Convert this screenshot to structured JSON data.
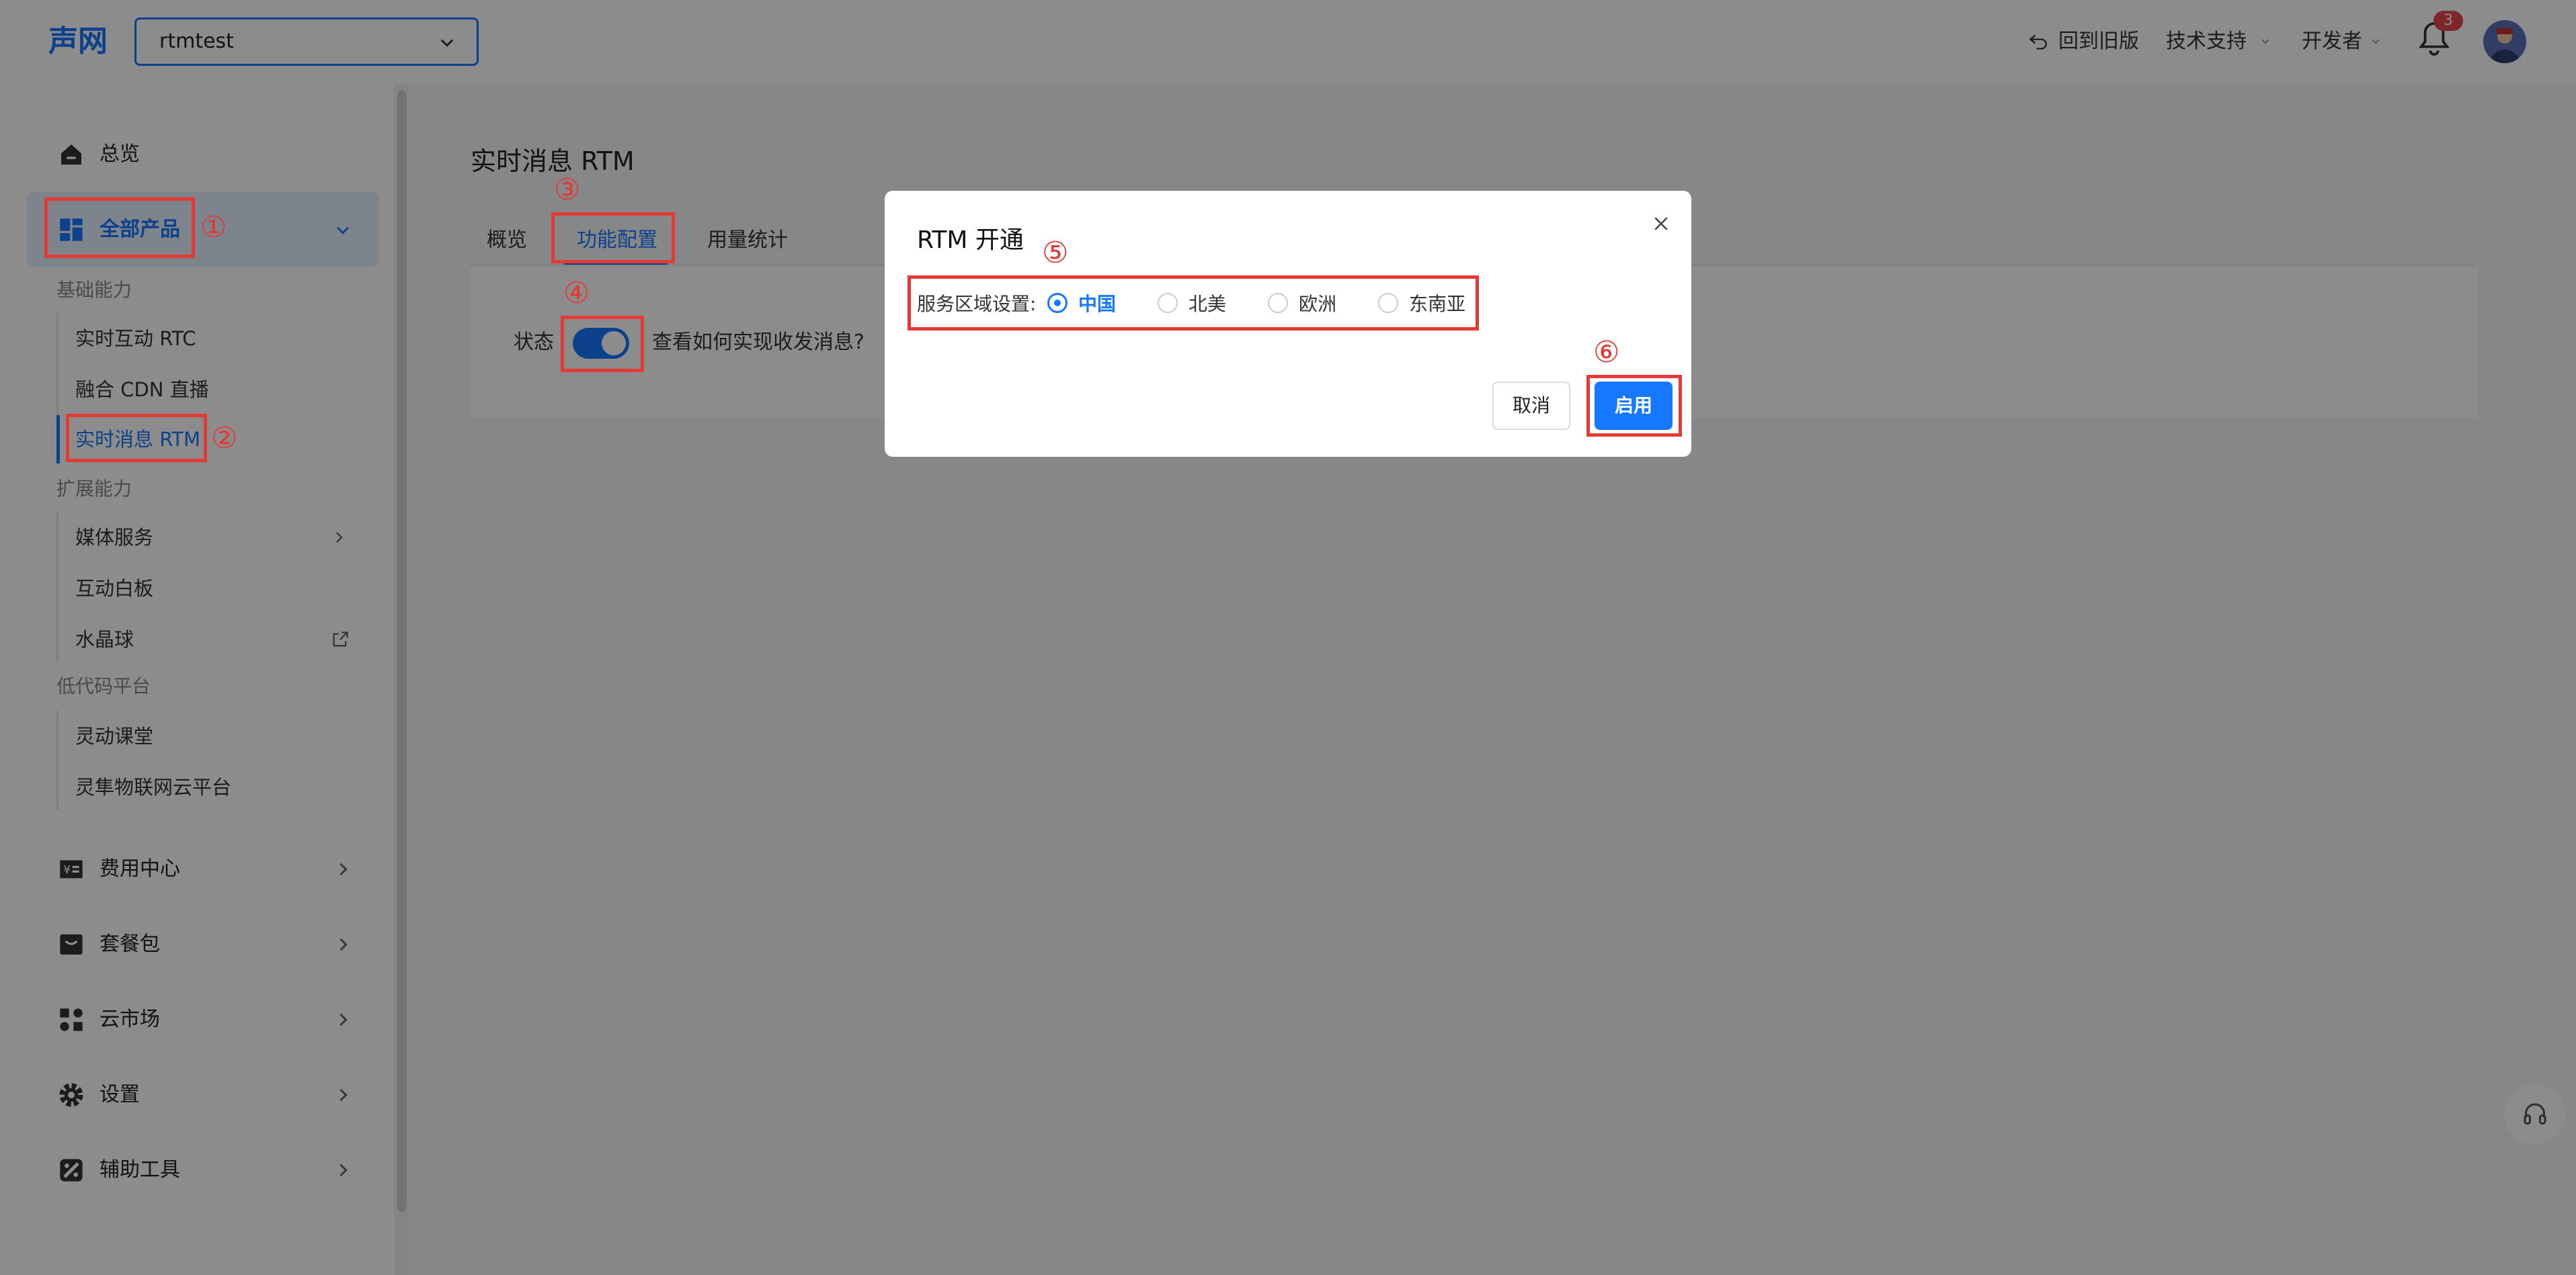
{
  "header": {
    "logo": "声网",
    "project": "rtmtest",
    "back_to_old": "回到旧版",
    "tech_support": "技术支持",
    "developer": "开发者",
    "notification_count": "3"
  },
  "sidebar": {
    "overview": "总览",
    "all_products": "全部产品",
    "section_basic": "基础能力",
    "rtc": "实时互动 RTC",
    "cdn": "融合 CDN 直播",
    "rtm": "实时消息 RTM",
    "section_ext": "扩展能力",
    "media": "媒体服务",
    "whiteboard": "互动白板",
    "crystal_ball": "水晶球",
    "section_lowcode": "低代码平台",
    "flexible_classroom": "灵动课堂",
    "iot": "灵隼物联网云平台",
    "billing": "费用中心",
    "packages": "套餐包",
    "marketplace": "云市场",
    "settings": "设置",
    "tools": "辅助工具"
  },
  "main": {
    "title": "实时消息 RTM",
    "tabs": [
      "概览",
      "功能配置",
      "用量统计"
    ],
    "status_label": "状态",
    "help_link": "查看如何实现收发消息?"
  },
  "modal": {
    "title": "RTM 开通",
    "region_label": "服务区域设置:",
    "regions": [
      "中国",
      "北美",
      "欧洲",
      "东南亚"
    ],
    "selected_region": "中国",
    "cancel": "取消",
    "enable": "启用"
  },
  "annotations": [
    "①",
    "②",
    "③",
    "④",
    "⑤",
    "⑥"
  ],
  "colors": {
    "accent": "#1677ff",
    "annotation": "#e53935"
  }
}
